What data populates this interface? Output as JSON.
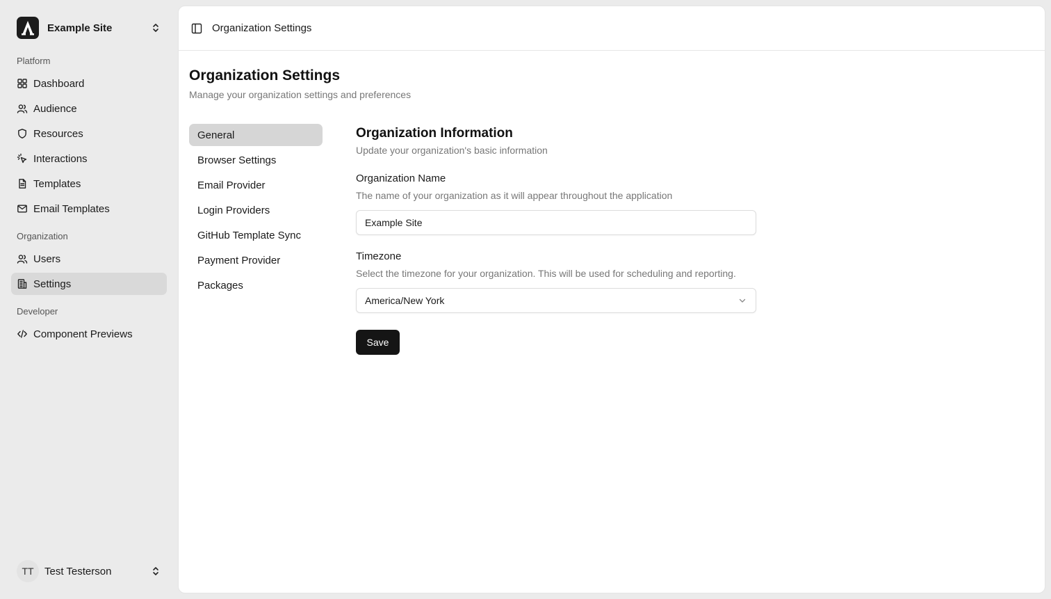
{
  "org": {
    "name": "Example Site",
    "logo_letter": "A"
  },
  "sidebar": {
    "groups": [
      {
        "label": "Platform"
      },
      {
        "label": "Organization"
      },
      {
        "label": "Developer"
      }
    ],
    "items": [
      {
        "label": "Dashboard",
        "icon": "grid-icon"
      },
      {
        "label": "Audience",
        "icon": "users-icon"
      },
      {
        "label": "Resources",
        "icon": "shield-icon"
      },
      {
        "label": "Interactions",
        "icon": "pointer-click-icon"
      },
      {
        "label": "Templates",
        "icon": "file-text-icon"
      },
      {
        "label": "Email Templates",
        "icon": "mail-icon"
      },
      {
        "label": "Users",
        "icon": "users-icon"
      },
      {
        "label": "Settings",
        "icon": "building-icon",
        "active": true
      },
      {
        "label": "Component Previews",
        "icon": "code-icon"
      }
    ]
  },
  "user": {
    "initials": "TT",
    "name": "Test Testerson"
  },
  "topbar": {
    "title": "Organization Settings"
  },
  "page": {
    "title": "Organization Settings",
    "subtitle": "Manage your organization settings and preferences"
  },
  "subnav": [
    {
      "label": "General",
      "active": true
    },
    {
      "label": "Browser Settings"
    },
    {
      "label": "Email Provider"
    },
    {
      "label": "Login Providers"
    },
    {
      "label": "GitHub Template Sync"
    },
    {
      "label": "Payment Provider"
    },
    {
      "label": "Packages"
    }
  ],
  "form": {
    "section_title": "Organization Information",
    "section_subtitle": "Update your organization's basic information",
    "name_label": "Organization Name",
    "name_help": "The name of your organization as it will appear throughout the application",
    "name_value": "Example Site",
    "timezone_label": "Timezone",
    "timezone_help": "Select the timezone for your organization. This will be used for scheduling and reporting.",
    "timezone_value": "America/New York",
    "save_label": "Save"
  },
  "colors": {
    "accent": "#151515",
    "active_bg": "#d9d9d9",
    "page_bg": "#ebebeb"
  }
}
